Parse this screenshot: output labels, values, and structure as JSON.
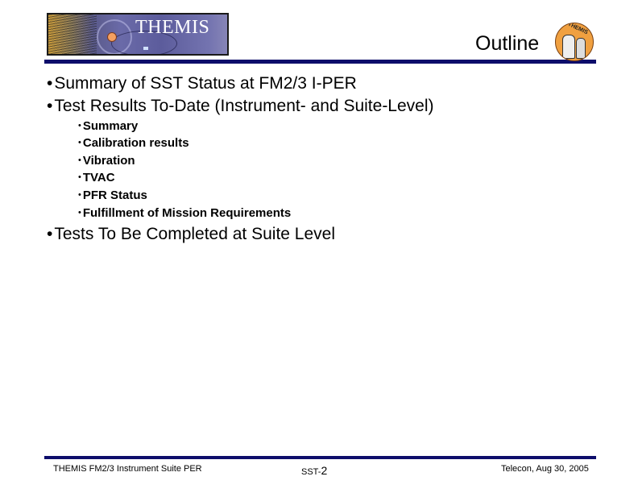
{
  "header": {
    "banner_title": "THEMIS",
    "slide_title": "Outline",
    "logo_text": "THEMIS"
  },
  "content": {
    "bullet_char": "•",
    "sub_bullet_char": "•",
    "items": [
      "Summary of SST Status at FM2/3 I-PER",
      "Test Results To-Date (Instrument- and Suite-Level)"
    ],
    "sub_items": [
      "Summary",
      "Calibration results",
      "Vibration",
      "TVAC",
      "PFR Status",
      "Fulfillment of Mission Requirements"
    ],
    "last_item": "Tests To Be Completed at Suite Level"
  },
  "footer": {
    "left": "THEMIS FM2/3 Instrument Suite PER",
    "center_prefix": "SST-",
    "center_number": "2",
    "right": "Telecon, Aug 30, 2005"
  },
  "colors": {
    "rule": "#0d0d6b",
    "banner_purple": "#6a6aa8",
    "logo_orange": "#f0a040"
  }
}
